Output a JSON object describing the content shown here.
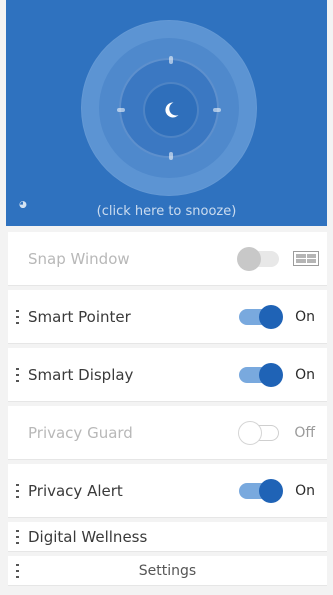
{
  "hero": {
    "snooze_text": "(click here to snooze)",
    "small_icon_glyph": "◕",
    "center_icon": "moon-icon",
    "background_color": "#2f72bf"
  },
  "rows": {
    "snap_window": {
      "label": "Snap Window",
      "enabled": false
    },
    "smart_pointer": {
      "label": "Smart Pointer",
      "state": "On"
    },
    "smart_display": {
      "label": "Smart Display",
      "state": "On"
    },
    "privacy_guard": {
      "label": "Privacy Guard",
      "state": "Off",
      "enabled": false
    },
    "privacy_alert": {
      "label": "Privacy Alert",
      "state": "On"
    },
    "digital_wellness": {
      "label": "Digital Wellness"
    },
    "settings": {
      "label": "Settings"
    }
  },
  "colors": {
    "accent": "#1f63b6",
    "toggle_track_on": "#79a9de"
  }
}
